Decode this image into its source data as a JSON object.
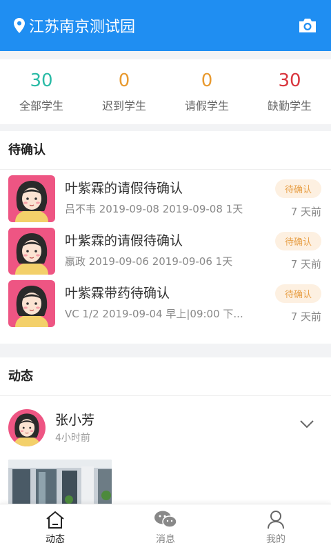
{
  "header": {
    "location": "江苏南京测试园",
    "location_icon": "location-pin-icon",
    "camera_icon": "camera-icon"
  },
  "stats": [
    {
      "value": "30",
      "label": "全部学生",
      "color": "#2bbba6"
    },
    {
      "value": "0",
      "label": "迟到学生",
      "color": "#e89a30"
    },
    {
      "value": "0",
      "label": "请假学生",
      "color": "#e89a30"
    },
    {
      "value": "30",
      "label": "缺勤学生",
      "color": "#d9363e"
    }
  ],
  "pending": {
    "title": "待确认",
    "items": [
      {
        "title": "叶紫霖的请假待确认",
        "sub": "吕不韦  2019-09-08  2019-09-08  1天",
        "badge": "待确认",
        "time": "7 天前"
      },
      {
        "title": "叶紫霖的请假待确认",
        "sub": "嬴政  2019-09-06  2019-09-06  1天",
        "badge": "待确认",
        "time": "7 天前"
      },
      {
        "title": "叶紫霖带药待确认",
        "sub": "VC  1/2  2019-09-04  早上|09:00  下...",
        "badge": "待确认",
        "time": "7 天前"
      }
    ]
  },
  "feed": {
    "title": "动态",
    "post": {
      "name": "张小芳",
      "ago": "4小时前"
    }
  },
  "tabbar": [
    {
      "label": "动态",
      "icon": "home-icon",
      "active": true
    },
    {
      "label": "消息",
      "icon": "chat-icon",
      "active": false
    },
    {
      "label": "我的",
      "icon": "user-icon",
      "active": false
    }
  ]
}
